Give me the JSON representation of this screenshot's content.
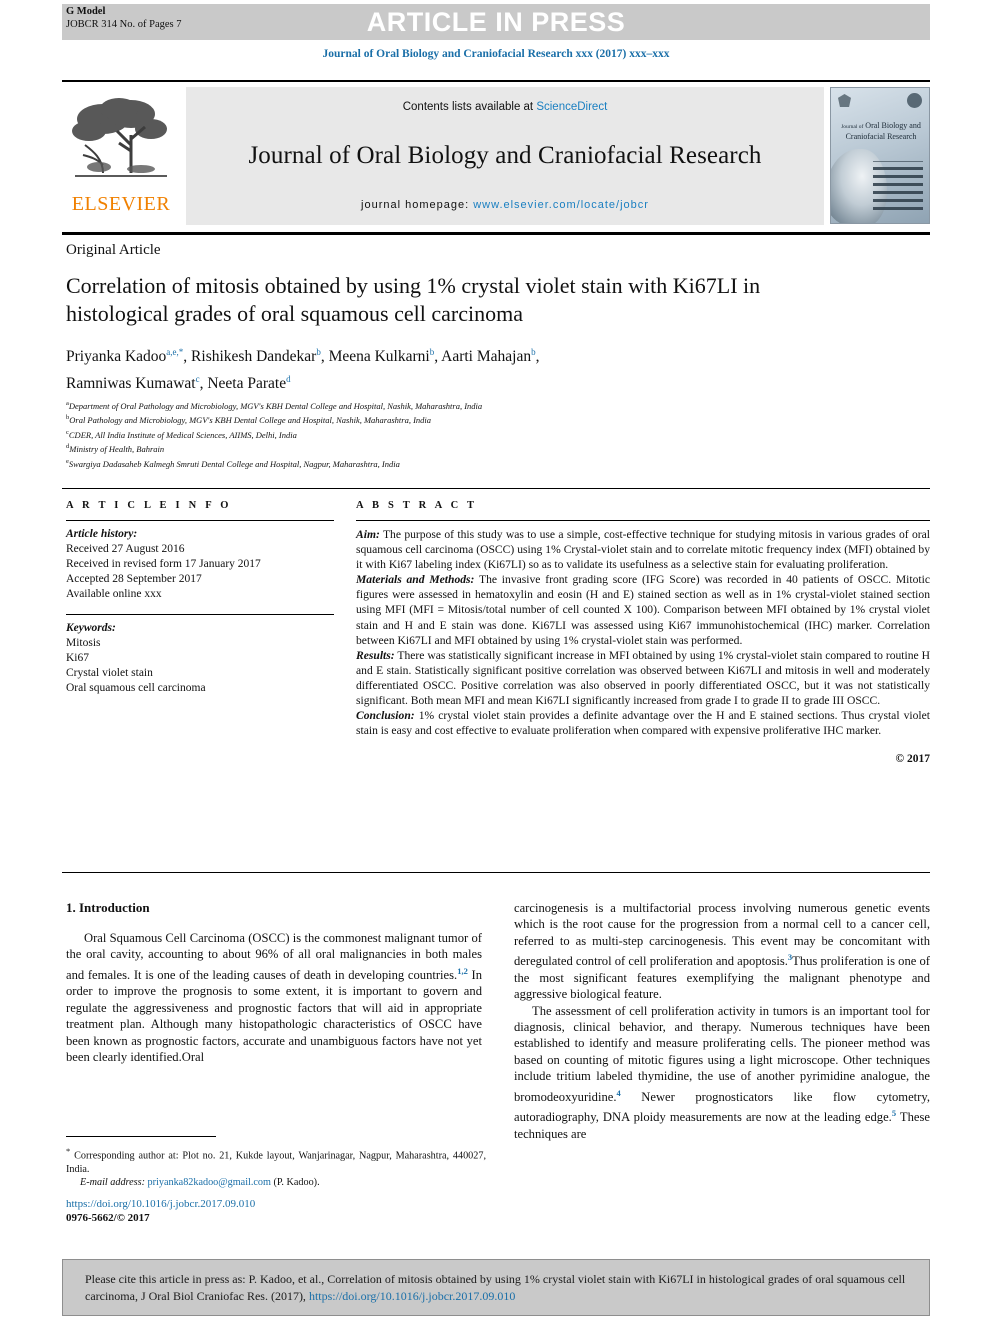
{
  "banner": {
    "gmodel_line1": "G Model",
    "gmodel_line2": "JOBCR 314 No. of Pages 7",
    "article_in_press": "ARTICLE IN PRESS"
  },
  "journal_ref": "Journal of Oral Biology and Craniofacial Research xxx (2017) xxx–xxx",
  "masthead": {
    "publisher": "ELSEVIER",
    "contents_prefix": "Contents lists available at ",
    "contents_link": "ScienceDirect",
    "journal_name": "Journal of Oral Biology and Craniofacial Research",
    "homepage_label": "journal homepage: ",
    "homepage_url": "www.elsevier.com/locate/jobcr",
    "cover_title_small": "Journal of",
    "cover_title_main": "Oral Biology and",
    "cover_title_main2": "Craniofacial Research"
  },
  "article": {
    "kicker": "Original Article",
    "title_line1": "Correlation of mitosis obtained by using 1% crystal violet stain with",
    "title_line2": "Ki67LI in histological grades of oral squamous cell carcinoma",
    "authors": [
      {
        "name": "Priyanka Kadoo",
        "sup": "a,e,*",
        "sep": ", "
      },
      {
        "name": "Rishikesh Dandekar",
        "sup": "b",
        "sep": ", "
      },
      {
        "name": "Meena Kulkarni",
        "sup": "b",
        "sep": ", "
      },
      {
        "name": "Aarti Mahajan",
        "sup": "b",
        "sep": ","
      },
      {
        "name": "Ramniwas Kumawat",
        "sup": "c",
        "sep": ", "
      },
      {
        "name": "Neeta Parate",
        "sup": "d",
        "sep": ""
      }
    ],
    "affiliations": [
      {
        "sup": "a",
        "text": "Department of Oral Pathology and Microbiology, MGV's KBH Dental College and Hospital, Nashik, Maharashtra, India"
      },
      {
        "sup": "b",
        "text": "Oral Pathology and Microbiology, MGV's KBH Dental College and Hospital, Nashik, Maharashtra, India"
      },
      {
        "sup": "c",
        "text": "CDER, All India Institute of Medical Sciences, AIIMS, Delhi, India"
      },
      {
        "sup": "d",
        "text": "Ministry of Health, Bahrain"
      },
      {
        "sup": "e",
        "text": "Swargiya Dadasaheb Kalmegh Smruti Dental College and Hospital, Nagpur, Maharashtra, India"
      }
    ]
  },
  "info": {
    "heading": "A R T I C L E   I N F O",
    "history_label": "Article history:",
    "history": [
      "Received 27 August 2016",
      "Received in revised form 17 January 2017",
      "Accepted 28 September 2017",
      "Available online xxx"
    ],
    "keywords_label": "Keywords:",
    "keywords": [
      "Mitosis",
      "Ki67",
      "Crystal violet stain",
      "Oral squamous cell carcinoma"
    ]
  },
  "abstract": {
    "heading": "A B S T R A C T",
    "aim_label": "Aim:",
    "aim_text": " The purpose of this study was to use a simple, cost-effective technique for studying mitosis in various grades of oral squamous cell carcinoma (OSCC) using 1% Crystal-violet stain and to correlate mitotic frequency index (MFI) obtained by it with Ki67 labeling index (Ki67LI) so as to validate its usefulness as a selective stain for evaluating proliferation.",
    "methods_label": "Materials and Methods:",
    "methods_text": " The invasive front grading score (IFG Score) was recorded in 40 patients of OSCC. Mitotic figures were assessed in hematoxylin and eosin (H and E) stained section as well as in 1% crystal-violet stained section using MFI (MFI = Mitosis/total number of cell counted X 100). Comparison between MFI obtained by 1% crystal violet stain and H and E stain was done. Ki67LI was assessed using Ki67 immunohistochemical (IHC) marker. Correlation between Ki67LI and MFI obtained by using 1% crystal-violet stain was performed.",
    "results_label": "Results:",
    "results_text": " There was statistically significant increase in MFI obtained by using 1% crystal-violet stain compared to routine H and E stain. Statistically significant positive correlation was observed between Ki67LI and mitosis in well and moderately differentiated OSCC. Positive correlation was also observed in poorly differentiated OSCC, but it was not statistically significant. Both mean MFI and mean Ki67LI significantly increased from grade I to grade II to grade III OSCC.",
    "conclusion_label": "Conclusion:",
    "conclusion_text": " 1% crystal violet stain provides a definite advantage over the H and E stained sections. Thus crystal violet stain is easy and cost effective to evaluate proliferation when compared with expensive proliferative IHC marker.",
    "copyright": "© 2017"
  },
  "body": {
    "section_heading": "1. Introduction",
    "left_p1_a": "Oral Squamous Cell Carcinoma (OSCC) is the commonest malignant tumor of the oral cavity, accounting to about 96% of all oral malignancies in both males and females. It is one of the leading causes of death in developing countries.",
    "left_p1_sup": "1,2",
    "left_p1_b": " In order to improve the prognosis to some extent, it is important to govern and regulate the aggressiveness and prognostic factors that will aid in appropriate treatment plan. Although many histopathologic characteristics of OSCC have been known as prognostic factors, accurate and unambiguous factors have not yet been clearly identified.Oral",
    "right_p1_a": "carcinogenesis is a multifactorial process involving numerous genetic events which is the root cause for the progression from a normal cell to a cancer cell, referred to as multi-step carcinogenesis. This event may be concomitant with deregulated control of cell proliferation and apoptosis.",
    "right_p1_sup": "3",
    "right_p1_b": "Thus proliferation is one of the most significant features exemplifying the malignant phenotype and aggressive biological feature.",
    "right_p2_a": "The assessment of cell proliferation activity in tumors is an important tool for diagnosis, clinical behavior, and therapy. Numerous techniques have been established to identify and measure proliferating cells. The pioneer method was based on counting of mitotic figures using a light microscope. Other techniques include tritium labeled thymidine, the use of another pyrimidine analogue, the bromodeoxyuridine.",
    "right_p2_sup": "4",
    "right_p2_b": " Newer prognosticators like flow cytometry, autoradiography, DNA ploidy measurements are now at the leading edge.",
    "right_p2_sup2": "5",
    "right_p2_c": " These techniques are"
  },
  "footnotes": {
    "corresponding_marker": "*",
    "corresponding_text": " Corresponding author at: Plot no. 21, Kukde layout, Wanjarinagar, Nagpur, Maharashtra, 440027, India.",
    "email_label": "E-mail address:",
    "email_value": "priyanka82kadoo@gmail.com",
    "email_suffix": " (P. Kadoo).",
    "doi": "https://doi.org/10.1016/j.jobcr.2017.09.010",
    "issn": "0976-5662/© 2017"
  },
  "citation": {
    "prefix": "Please cite this article in press as: P. Kadoo, et al., Correlation of mitosis obtained by using 1% crystal violet stain with Ki67LI in histological grades of oral squamous cell carcinoma, J Oral Biol Craniofac Res. (2017), ",
    "link": "https://doi.org/10.1016/j.jobcr.2017.09.010"
  },
  "colors": {
    "link_blue": "#1a6fa8",
    "sciencedirect_blue": "#1a7fc1",
    "elsevier_orange": "#f08000",
    "banner_gray": "#c9c9c9",
    "masthead_gray": "#e8e8e8"
  }
}
